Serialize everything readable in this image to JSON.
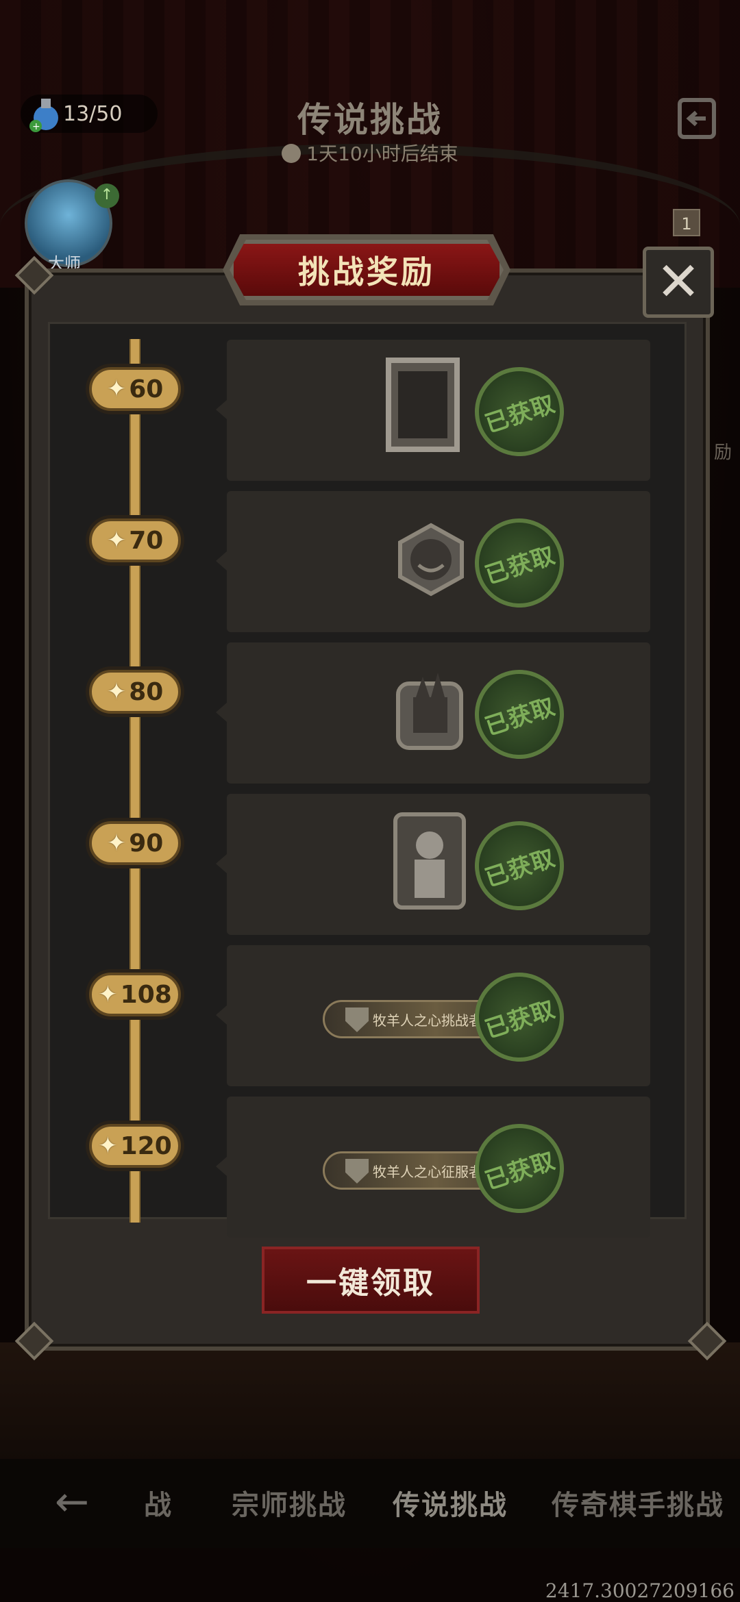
{
  "header": {
    "title": "传说挑战",
    "timer": "1天10小时后结束",
    "stamina": "13/50",
    "avatar_label": "大师",
    "side_text": "励",
    "badge_count": "1"
  },
  "modal": {
    "title": "挑战奖励",
    "claim_all_label": "一键领取",
    "claimed_stamp": "已获取",
    "rewards": [
      {
        "threshold": "60",
        "item": "frame"
      },
      {
        "threshold": "70",
        "item": "pumpkin-badge"
      },
      {
        "threshold": "80",
        "item": "castle-badge"
      },
      {
        "threshold": "90",
        "item": "character-card"
      },
      {
        "threshold": "108",
        "item": "title",
        "title_text": "牧羊人之心挑战者"
      },
      {
        "threshold": "120",
        "item": "title",
        "title_text": "牧羊人之心征服者"
      }
    ]
  },
  "tabs": [
    "战",
    "宗师挑战",
    "传说挑战",
    "传奇棋手挑战"
  ],
  "active_tab": "传说挑战",
  "coords_text": "2417.30027209166",
  "colors": {
    "gold": "#c9a155",
    "stamp_green": "#5b7a3e",
    "title_red": "#8a1616",
    "panel": "#2d2a26"
  }
}
